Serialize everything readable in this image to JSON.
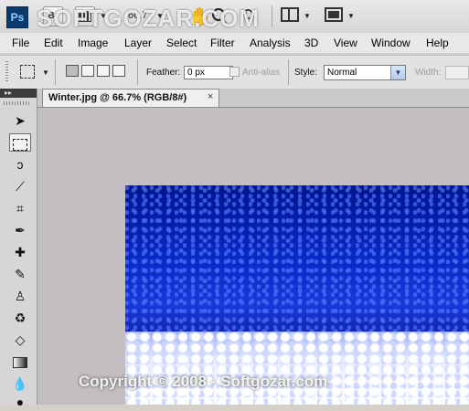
{
  "appbar": {
    "logo": "Ps",
    "bridge_label": "Br",
    "zoom_value": "66.7",
    "icons": [
      "bridge-icon",
      "filmstrip-icon",
      "hand-icon",
      "zoom-icon",
      "rotate-view-icon",
      "arrange-documents-icon",
      "screen-mode-icon"
    ]
  },
  "menu": [
    "File",
    "Edit",
    "Image",
    "Layer",
    "Select",
    "Filter",
    "Analysis",
    "3D",
    "View",
    "Window",
    "Help"
  ],
  "options": {
    "feather_label": "Feather:",
    "feather_value": "0 px",
    "antialias_label": "Anti-alias",
    "style_label": "Style:",
    "style_value": "Normal",
    "width_label": "Width:"
  },
  "document": {
    "tab_title": "Winter.jpg @ 66.7% (RGB/8#)",
    "close_glyph": "×"
  },
  "toolbox": {
    "collapse_glyph": "▸▸",
    "tools": [
      "move-tool",
      "rectangular-marquee-tool",
      "lasso-tool",
      "quick-selection-tool",
      "crop-tool",
      "eyedropper-tool",
      "spot-healing-tool",
      "brush-tool",
      "clone-stamp-tool",
      "history-brush-tool",
      "eraser-tool",
      "gradient-tool",
      "blur-tool",
      "dodge-tool"
    ],
    "active_tool": "rectangular-marquee-tool"
  },
  "watermark": {
    "logo_text": "SOFTGOZAR.COM",
    "copyright": "Copyright © 2008 - Softgozar.com"
  },
  "colors": {
    "photo_sky": "#0a2ac8",
    "canvas_bg": "#c2bec2",
    "tab_active": "#efefef"
  }
}
